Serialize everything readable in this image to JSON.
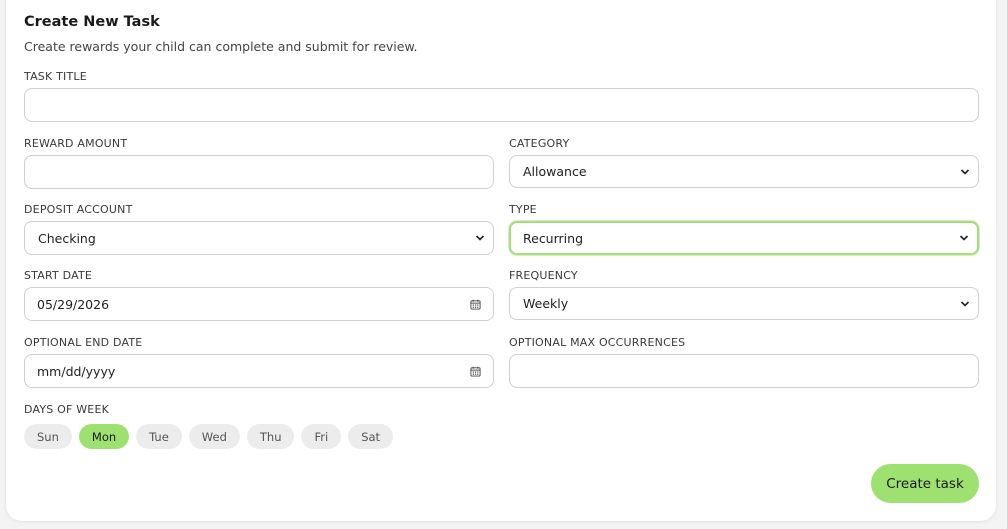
{
  "form": {
    "title": "Create New Task",
    "subtitle": "Create rewards your child can complete and submit for review.",
    "task_title_label": "TASK TITLE",
    "task_title_value": "",
    "reward_amount_label": "REWARD AMOUNT",
    "reward_amount_value": "",
    "category_label": "CATEGORY",
    "category_value": "Allowance",
    "deposit_account_label": "DEPOSIT ACCOUNT",
    "deposit_account_value": "Checking",
    "type_label": "TYPE",
    "type_value": "Recurring",
    "start_date_label": "START DATE",
    "start_date_value": "05/29/2026",
    "frequency_label": "FREQUENCY",
    "frequency_value": "Weekly",
    "end_date_label": "OPTIONAL END DATE",
    "end_date_placeholder": "mm/dd/yyyy",
    "max_occurrences_label": "OPTIONAL MAX OCCURRENCES",
    "max_occurrences_value": "",
    "days_label": "DAYS OF WEEK",
    "days": [
      {
        "label": "Sun",
        "selected": false
      },
      {
        "label": "Mon",
        "selected": true
      },
      {
        "label": "Tue",
        "selected": false
      },
      {
        "label": "Wed",
        "selected": false
      },
      {
        "label": "Thu",
        "selected": false
      },
      {
        "label": "Fri",
        "selected": false
      },
      {
        "label": "Sat",
        "selected": false
      }
    ],
    "submit_label": "Create task"
  },
  "colors": {
    "accent": "#9fe170",
    "focus_border": "#a6dd7f",
    "chip_bg": "#ececec"
  }
}
